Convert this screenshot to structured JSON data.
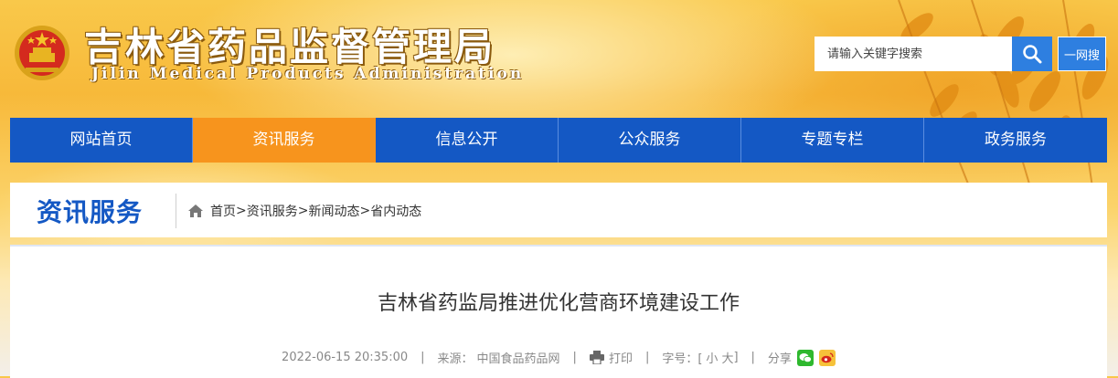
{
  "header": {
    "site_title": "吉林省药品监督管理局",
    "site_subtitle": "Jilin Medical Products Administration",
    "search_placeholder": "请输入关键字搜索",
    "web_search_label": "一网搜"
  },
  "nav": {
    "items": [
      {
        "label": "网站首页"
      },
      {
        "label": "资讯服务",
        "active": true
      },
      {
        "label": "信息公开"
      },
      {
        "label": "公众服务"
      },
      {
        "label": "专题专栏"
      },
      {
        "label": "政务服务"
      }
    ]
  },
  "section": {
    "title": "资讯服务",
    "breadcrumb": [
      "首页",
      "资讯服务",
      "新闻动态",
      "省内动态"
    ],
    "breadcrumb_separator": ">"
  },
  "article": {
    "title": "吉林省药监局推进优化营商环境建设工作",
    "datetime": "2022-06-15 20:35:00",
    "source_label": "来源：",
    "source": "中国食品药品网",
    "print_label": "打印",
    "font_size_label": "字号：[",
    "font_small": "小",
    "font_large": "大",
    "font_size_close": "]",
    "share_label": "分享"
  },
  "icons": {
    "emblem": "national-emblem",
    "search": "search-icon",
    "home": "home-icon",
    "print": "printer-icon",
    "wechat": "wechat-icon",
    "weibo": "weibo-icon"
  },
  "colors": {
    "primary_blue": "#1458c4",
    "active_orange": "#f7941d",
    "search_blue": "#2e7fe0"
  }
}
